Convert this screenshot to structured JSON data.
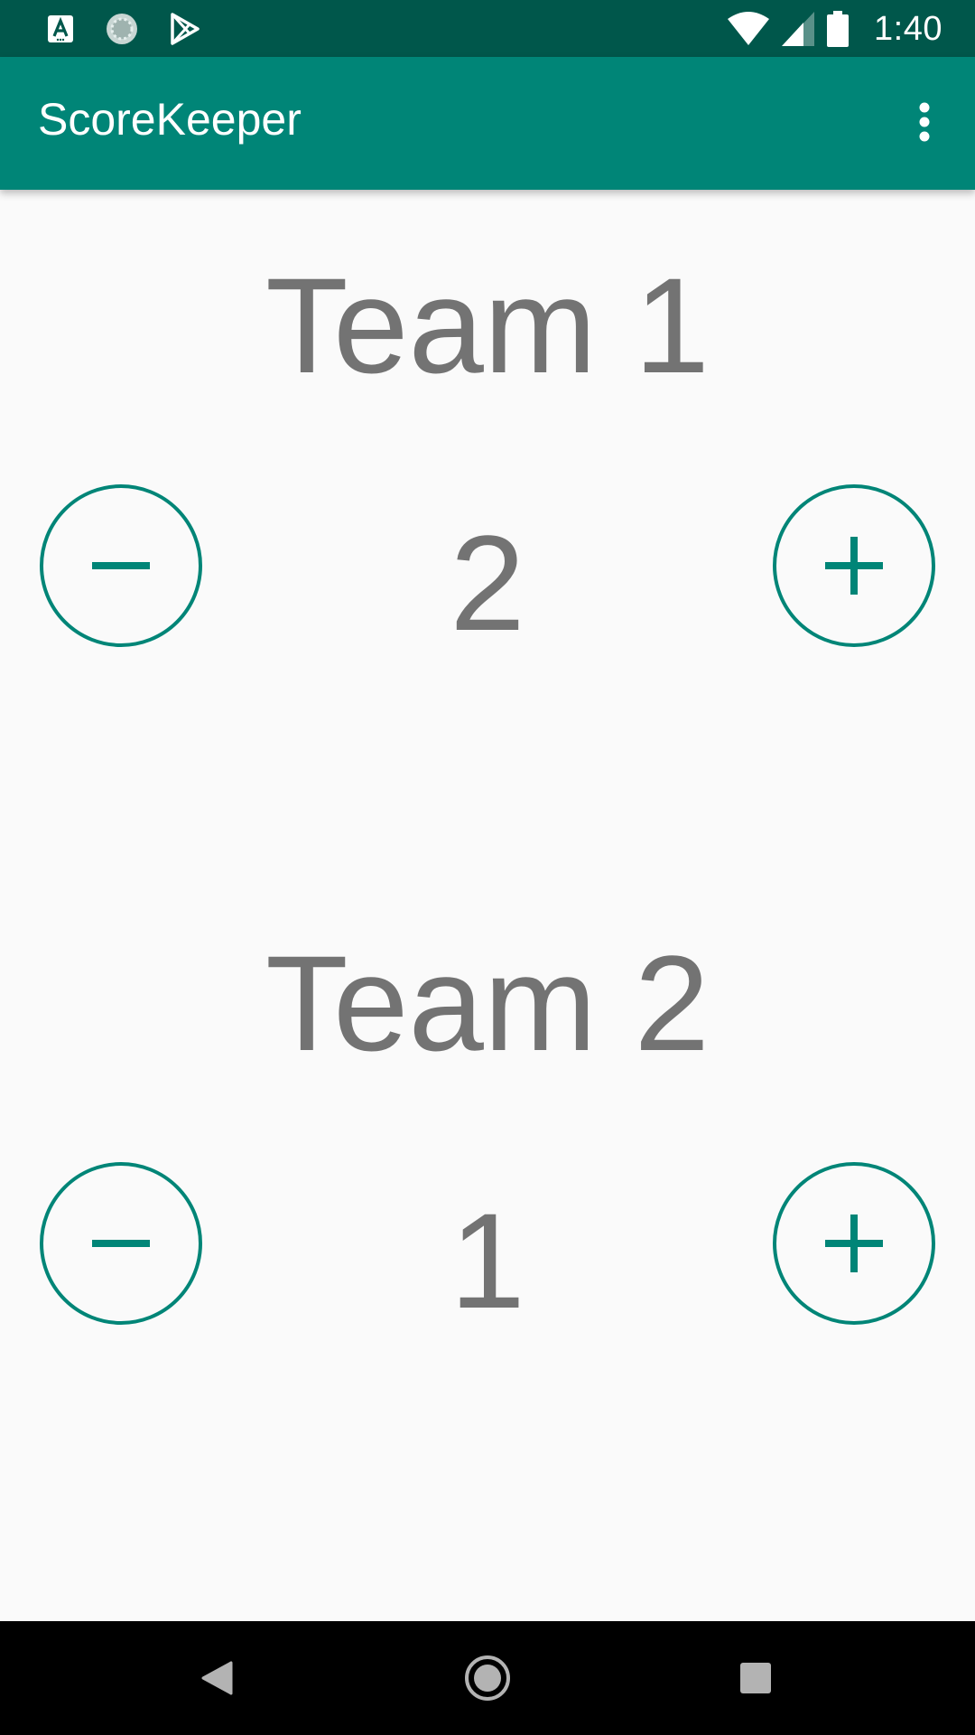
{
  "status_bar": {
    "time": "1:40",
    "notification_icons": [
      "accessibility-a-icon",
      "loading-circle-icon",
      "play-store-icon"
    ],
    "system_icons": [
      "wifi-icon",
      "cell-signal-icon",
      "battery-icon"
    ]
  },
  "app_bar": {
    "title": "ScoreKeeper",
    "overflow_icon": "more-vert-icon"
  },
  "teams": [
    {
      "name": "Team 1",
      "score": "2",
      "decrease_icon": "minus-icon",
      "increase_icon": "plus-icon"
    },
    {
      "name": "Team 2",
      "score": "1",
      "decrease_icon": "minus-icon",
      "increase_icon": "plus-icon"
    }
  ],
  "nav_bar": {
    "buttons": [
      "back-icon",
      "home-icon",
      "recents-icon"
    ]
  },
  "colors": {
    "status_bar": "#00574b",
    "primary": "#008577",
    "accent": "#008577",
    "text": "#737373",
    "background": "#fafafa",
    "nav_bar": "#000000"
  }
}
